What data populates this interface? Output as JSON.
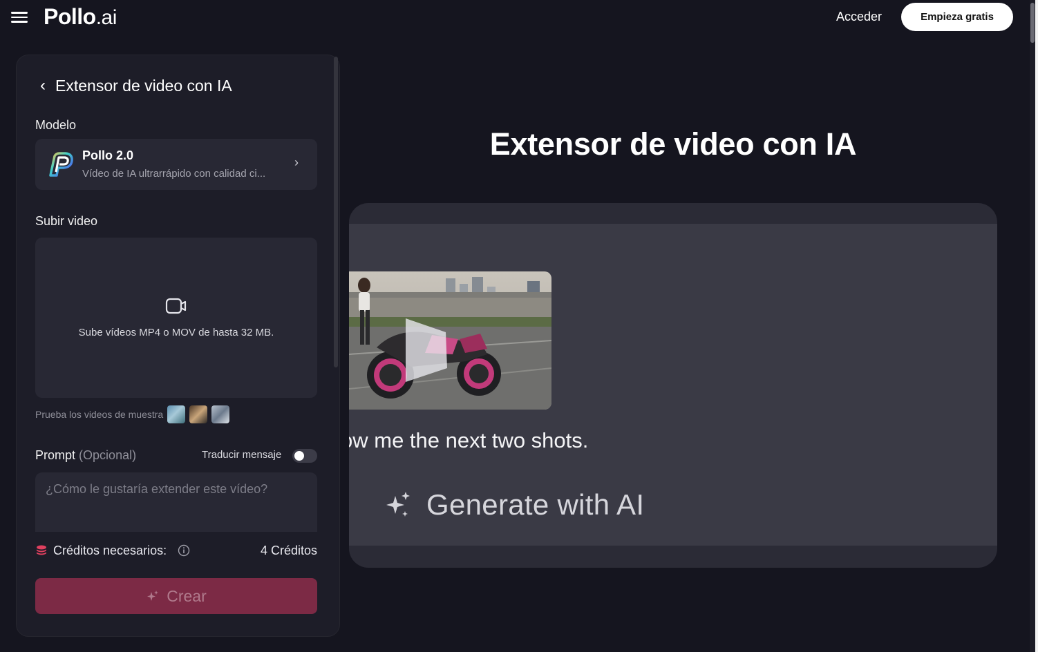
{
  "header": {
    "logo_main": "Pollo",
    "logo_suffix": ".ai",
    "signin_label": "Acceder",
    "start_label": "Empieza gratis"
  },
  "panel": {
    "title": "Extensor de video con IA",
    "model_label": "Modelo",
    "model": {
      "name": "Pollo 2.0",
      "description": "Vídeo de IA ultrarrápido con calidad ci..."
    },
    "upload_label": "Subir video",
    "upload_hint": "Sube vídeos MP4 o MOV de hasta 32 MB.",
    "samples_text": "Prueba los videos de muestra",
    "prompt_label": "Prompt",
    "prompt_optional": "(Opcional)",
    "translate_label": "Traducir mensaje",
    "translate_enabled": false,
    "prompt_placeholder": "¿Cómo le gustaría extender este vídeo?",
    "credits_label": "Créditos necesarios:",
    "credits_value": "4 Créditos",
    "create_label": "Crear"
  },
  "main": {
    "hero_title": "Extensor de video con IA",
    "demo_prompt_text": "ow me the next two shots.",
    "demo_generate_text": "Generate with AI"
  },
  "colors": {
    "background": "#15151f",
    "panel": "#1d1d28",
    "card": "#282834",
    "accent_button": "#7c2a45",
    "brand_pink": "#e0405f"
  }
}
